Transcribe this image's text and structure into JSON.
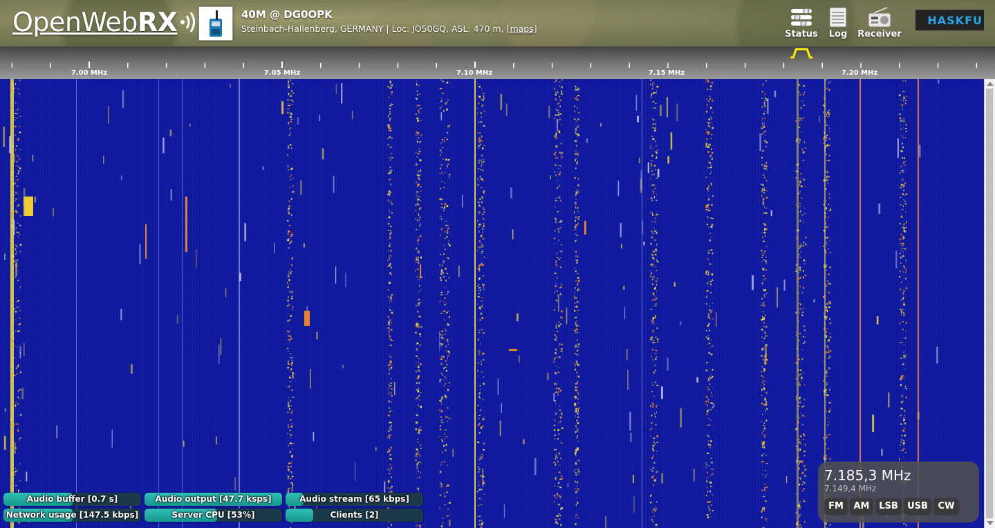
{
  "header": {
    "logo_text_light": "OpenWeb",
    "logo_text_bold": "RX",
    "receiver_title": "40M @ DG0OPK",
    "receiver_desc": "Steinbach-Hallenberg, GERMANY | Loc: JO50GQ, ASL: 470 m, ",
    "maps_link": "[maps]",
    "buttons": {
      "status": "Status",
      "log": "Log",
      "receiver": "Receiver"
    },
    "sponsor_text": "HASKFU",
    "icons": {
      "logo": "radio-waves-icon",
      "receiver_photo": "radio-transceiver-icon",
      "status": "sliders-icon",
      "log": "notepad-icon",
      "receiver": "radio-receiver-icon"
    }
  },
  "scale": {
    "labels": [
      "7.00 MHz",
      "7.05 MHz",
      "7.10 MHz",
      "7.15 MHz",
      "7.20 MHz"
    ],
    "filter_marker_freq_mhz": 7.185
  },
  "status_bars": {
    "audio_buffer": {
      "label": "Audio buffer [0.7 s]",
      "fill": 0.5
    },
    "audio_output": {
      "label": "Audio output [47.7 ksps]",
      "fill": 1.0
    },
    "audio_stream": {
      "label": "Audio stream [65 kbps]",
      "fill": 0.13
    },
    "network_usage": {
      "label": "Network usage [147.5 kbps]",
      "fill": 0.5
    },
    "server_cpu": {
      "label": "Server CPU [53%]",
      "fill": 0.53
    },
    "clients": {
      "label": "Clients [2]",
      "fill": 0.2
    }
  },
  "frequency_panel": {
    "current_freq": "7.185,3 MHz",
    "secondary_freq": "7.149,4 MHz",
    "modes": [
      "FM",
      "AM",
      "LSB",
      "USB",
      "CW"
    ]
  },
  "colors": {
    "waterfall_bg": "#121aa0",
    "signal_yellow": "#f2e03a",
    "signal_orange": "#ff8c1a",
    "progress_fill": "#2fc0b5",
    "filter_marker": "#ffee00"
  }
}
